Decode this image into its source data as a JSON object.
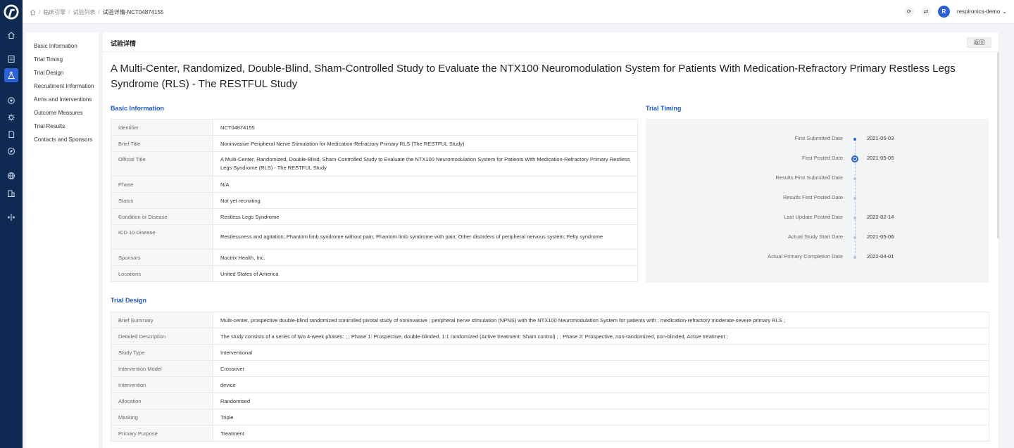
{
  "breadcrumb": {
    "items": [
      "临床引擎",
      "试验列表"
    ],
    "current": "试验详情-NCT04874155"
  },
  "user": {
    "initial": "R",
    "name": "respironics-demo"
  },
  "subnav": [
    "Basic Information",
    "Trial Timing",
    "Trial Design",
    "Recruitment Information",
    "Arms and Interventions",
    "Outcome Measures",
    "Trial Results",
    "Contacts and Sponsors"
  ],
  "panel": {
    "title": "试验详情",
    "back_label": "返回"
  },
  "trial_title": "A Multi-Center, Randomized, Double-Blind, Sham-Controlled Study to Evaluate the NTX100 Neuromodulation System for Patients With Medication-Refractory Primary Restless Legs Syndrome (RLS) - The RESTFUL Study",
  "basic_info": {
    "section_title": "Basic Information",
    "rows": [
      {
        "k": "Identifier",
        "v": "NCT04874155"
      },
      {
        "k": "Brief Title",
        "v": "Noninvasive Peripheral Nerve Stimulation for Medication-Refractory Primary RLS (The RESTFUL Study)"
      },
      {
        "k": "Official Title",
        "v": "A Multi-Center, Randomized, Double-Blind, Sham-Controlled Study to Evaluate the NTX100 Neuromodulation System for Patients With Medication-Refractory Primary Restless Legs Syndrome (RLS) - The RESTFUL Study"
      },
      {
        "k": "Phase",
        "v": "N/A"
      },
      {
        "k": "Status",
        "v": "Not yet recruiting"
      },
      {
        "k": "Condition or Disease",
        "v": "Restless Legs Syndrome"
      },
      {
        "k": "ICD 10 Disease",
        "v": "Restlessness and agitation; Phantom limb syndrome without pain; Phantom limb syndrome with pain; Other disorders of peripheral nervous system; Felty syndrome"
      },
      {
        "k": "Sponsors",
        "v": "Noctrix Health, Inc."
      },
      {
        "k": "Locations",
        "v": "United States of America"
      }
    ]
  },
  "trial_timing": {
    "section_title": "Trial Timing",
    "events": [
      {
        "label": "First Submitted Date",
        "date": "2021-05-03",
        "marker": "fill"
      },
      {
        "label": "First Posted Date",
        "date": "2021-05-05",
        "marker": "ring"
      },
      {
        "label": "Results First Submitted Date",
        "date": "",
        "marker": "empty"
      },
      {
        "label": "Results First Posted Date",
        "date": "",
        "marker": "empty"
      },
      {
        "label": "Last Update Posted Date",
        "date": "2022-02-14",
        "marker": "empty"
      },
      {
        "label": "Actual Study Start Date",
        "date": "2021-05-06",
        "marker": "empty"
      },
      {
        "label": "Actual Primary Completion Date",
        "date": "2022-04-01",
        "marker": "empty"
      }
    ]
  },
  "trial_design": {
    "section_title": "Trial Design",
    "rows": [
      {
        "k": "Brief Summary",
        "v": "Multi-center, prospective double-blind randomized controlled pivotal study of noninvasive ; peripheral nerve stimulation (NPNS) with the NTX100 Neuromodulation System for patients with ; medication-refractory moderate-severe primary RLS ;"
      },
      {
        "k": "Detailed Description",
        "v": "The study consists of a series of two 4-week phases: ; ; Phase 1: Prospective, double-blinded, 1:1 randomized (Active treatment: Sham control) ; ; Phase 2: Prospective, non-randomized, non-blinded, Active treatment ;"
      },
      {
        "k": "Study Type",
        "v": "Interventional"
      },
      {
        "k": "Intervention Model",
        "v": "Crossover"
      },
      {
        "k": "Intervention",
        "v": "device"
      },
      {
        "k": "Allocation",
        "v": "Randomised"
      },
      {
        "k": "Masking",
        "v": "Triple"
      },
      {
        "k": "Primary Purpose",
        "v": "Treatment"
      }
    ]
  }
}
